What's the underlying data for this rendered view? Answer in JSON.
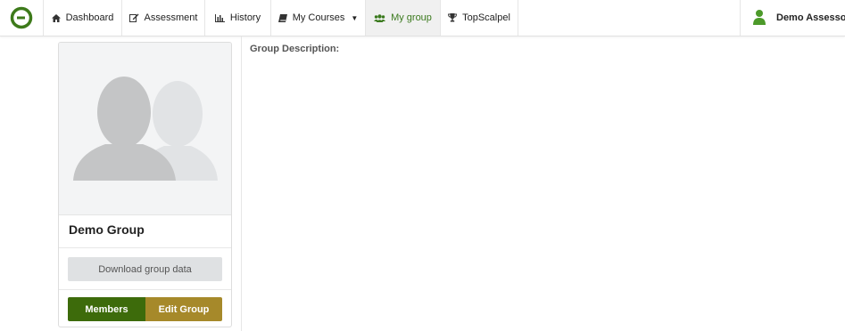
{
  "brand": {
    "logo_icon": "brand-logo-icon",
    "accent": "#3b7a1e"
  },
  "nav": {
    "items": [
      {
        "label": "Dashboard",
        "icon": "home-icon"
      },
      {
        "label": "Assessment",
        "icon": "edit-icon"
      },
      {
        "label": "History",
        "icon": "bar-chart-icon"
      },
      {
        "label": "My Courses",
        "icon": "book-icon",
        "dropdown": true
      },
      {
        "label": "My group",
        "icon": "users-icon",
        "active": true
      },
      {
        "label": "TopScalpel",
        "icon": "trophy-icon"
      }
    ],
    "user_name": "Demo Assessor",
    "user_icon": "user-icon"
  },
  "group": {
    "avatar_icon": "group-avatar-icon",
    "name": "Demo Group",
    "download_label": "Download group data",
    "members_label": "Members",
    "edit_label": "Edit Group",
    "members_color": "#3d6b0b",
    "edit_color": "#a6892a"
  },
  "main": {
    "description_label": "Group Description:"
  }
}
